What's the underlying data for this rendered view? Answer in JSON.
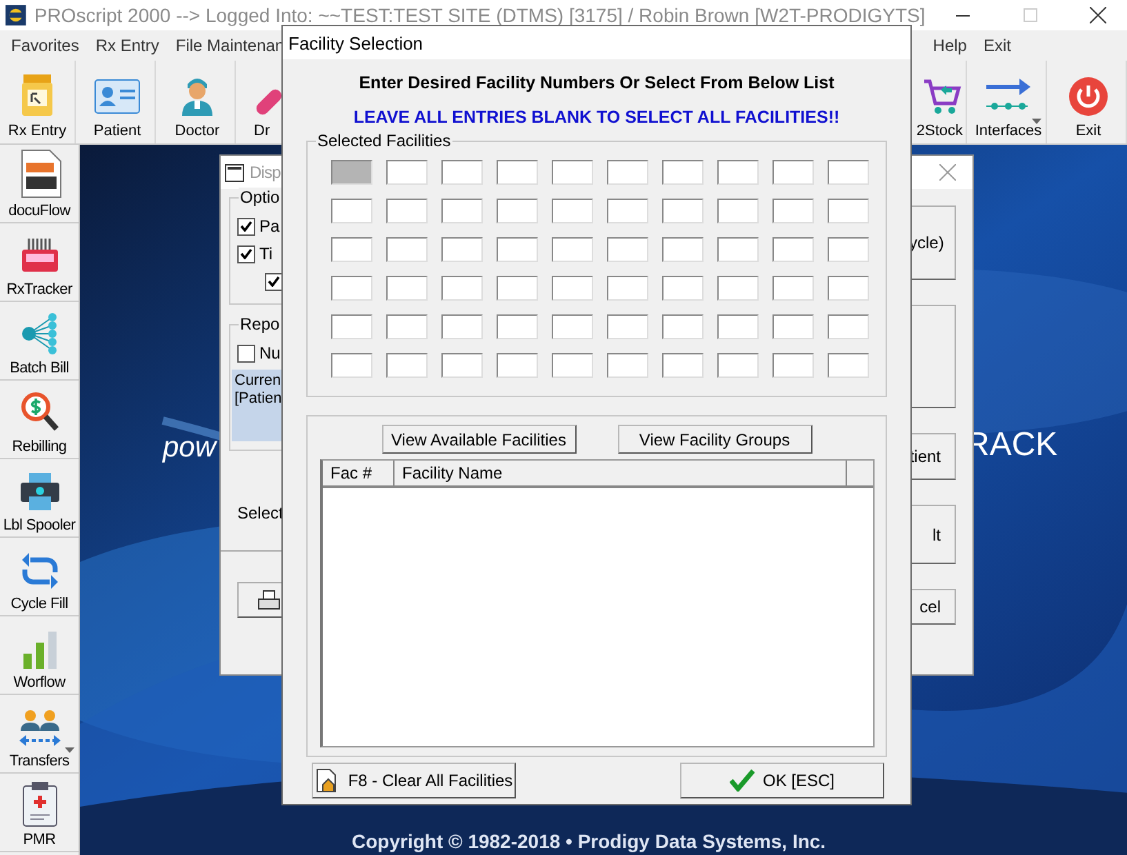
{
  "main_window": {
    "title": "PROscript 2000 --> Logged Into: ~~TEST:TEST SITE (DTMS) [3175] / Robin Brown [W2T-PRODIGYTS]",
    "menu": [
      {
        "label": "Favorites"
      },
      {
        "label": "Rx Entry"
      },
      {
        "label": "File Maintenan"
      }
    ],
    "menu_right": [
      {
        "label": "Help"
      },
      {
        "label": "Exit"
      }
    ],
    "toolbar_left": [
      {
        "label": "Rx Entry",
        "dropdown": false
      },
      {
        "label": "Patient",
        "dropdown": false
      },
      {
        "label": "Doctor",
        "dropdown": false
      },
      {
        "label": "Dr",
        "dropdown": false
      }
    ],
    "toolbar_right": [
      {
        "label": "2Stock",
        "dropdown": false
      },
      {
        "label": "Interfaces",
        "dropdown": true
      },
      {
        "label": "Exit",
        "dropdown": false
      }
    ],
    "sidebar": [
      {
        "label": "docuFlow",
        "dropdown": false
      },
      {
        "label": "RxTracker",
        "dropdown": false
      },
      {
        "label": "Batch Bill",
        "dropdown": false
      },
      {
        "label": "Rebilling",
        "dropdown": false
      },
      {
        "label": "Lbl Spooler",
        "dropdown": false
      },
      {
        "label": "Cycle Fill",
        "dropdown": false
      },
      {
        "label": "Worflow",
        "dropdown": false
      },
      {
        "label": "Transfers",
        "dropdown": true
      },
      {
        "label": "PMR",
        "dropdown": false
      }
    ],
    "splash": {
      "fragment_left": "pow",
      "fragment_right": "RACK",
      "copyright": "Copyright © 1982-2018 • Prodigy Data Systems, Inc."
    }
  },
  "display_window": {
    "title": "Disp",
    "options_group": "Optio",
    "options": [
      {
        "label": "Pa",
        "checked": true
      },
      {
        "label": "Ti",
        "checked": true
      },
      {
        "checked": true
      }
    ],
    "report_group": "Repo",
    "report_options": [
      {
        "label": "Nu",
        "checked": false
      }
    ],
    "current_lines": [
      "Curren",
      "[Patien"
    ],
    "select_label": "Select",
    "right_buttons": [
      {
        "kind": "text",
        "label": "ycle)"
      },
      {
        "kind": "blank"
      },
      {
        "kind": "text",
        "label": "tient"
      },
      {
        "kind": "text",
        "label": "lt"
      },
      {
        "kind": "text",
        "label": "cel"
      }
    ]
  },
  "facility_dialog": {
    "title": "Facility Selection",
    "instruction": "Enter Desired Facility Numbers Or Select From Below List",
    "warning": "LEAVE ALL ENTRIES BLANK TO SELECT ALL FACILITIES!!",
    "selected_group": "Selected Facilities",
    "field_rows": [
      [
        {
          "selected": true
        },
        {
          "selected": false
        },
        {
          "selected": false
        },
        {
          "selected": false
        },
        {
          "selected": false
        },
        {
          "selected": false
        },
        {
          "selected": false
        },
        {
          "selected": false
        },
        {
          "selected": false
        },
        {
          "selected": false
        }
      ],
      [
        {
          "selected": false
        },
        {
          "selected": false
        },
        {
          "selected": false
        },
        {
          "selected": false
        },
        {
          "selected": false
        },
        {
          "selected": false
        },
        {
          "selected": false
        },
        {
          "selected": false
        },
        {
          "selected": false
        },
        {
          "selected": false
        }
      ],
      [
        {
          "selected": false
        },
        {
          "selected": false
        },
        {
          "selected": false
        },
        {
          "selected": false
        },
        {
          "selected": false
        },
        {
          "selected": false
        },
        {
          "selected": false
        },
        {
          "selected": false
        },
        {
          "selected": false
        },
        {
          "selected": false
        }
      ],
      [
        {
          "selected": false
        },
        {
          "selected": false
        },
        {
          "selected": false
        },
        {
          "selected": false
        },
        {
          "selected": false
        },
        {
          "selected": false
        },
        {
          "selected": false
        },
        {
          "selected": false
        },
        {
          "selected": false
        },
        {
          "selected": false
        }
      ],
      [
        {
          "selected": false
        },
        {
          "selected": false
        },
        {
          "selected": false
        },
        {
          "selected": false
        },
        {
          "selected": false
        },
        {
          "selected": false
        },
        {
          "selected": false
        },
        {
          "selected": false
        },
        {
          "selected": false
        },
        {
          "selected": false
        }
      ],
      [
        {
          "selected": false
        },
        {
          "selected": false
        },
        {
          "selected": false
        },
        {
          "selected": false
        },
        {
          "selected": false
        },
        {
          "selected": false
        },
        {
          "selected": false
        },
        {
          "selected": false
        },
        {
          "selected": false
        },
        {
          "selected": false
        }
      ]
    ],
    "view_buttons": [
      "View Available Facilities",
      "View Facility Groups"
    ],
    "table": {
      "columns": [
        "Fac #",
        "Facility Name"
      ]
    },
    "clear_button": "F8 - Clear All Facilities",
    "ok_button": "OK [ESC]"
  }
}
